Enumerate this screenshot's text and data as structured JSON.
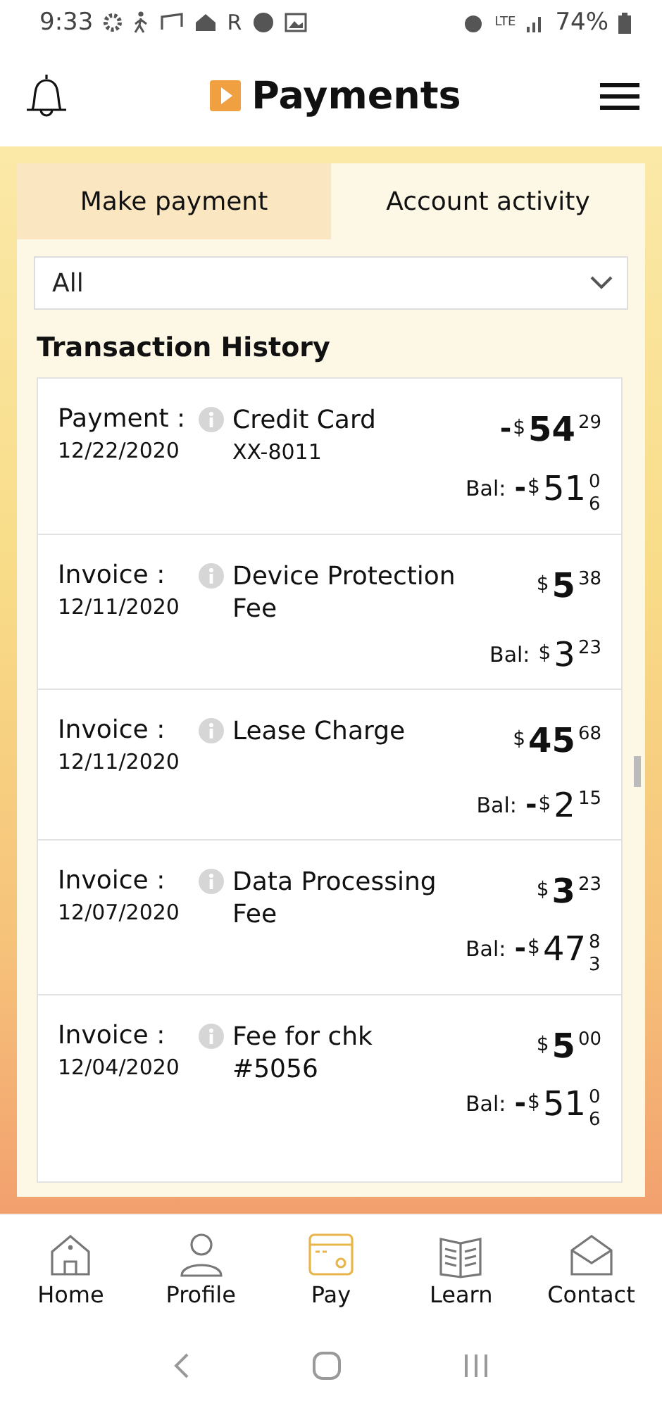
{
  "status_bar": {
    "time": "9:33",
    "carrier_mark": "R",
    "network": "LTE",
    "battery": "74%"
  },
  "header": {
    "title": "Payments"
  },
  "tabs": [
    {
      "label": "Make payment",
      "selected": false
    },
    {
      "label": "Account activity",
      "selected": true
    }
  ],
  "filter": {
    "value": "All"
  },
  "section_title": "Transaction History",
  "transactions": [
    {
      "type": "Payment :",
      "date": "12/22/2020",
      "description": "Credit Card",
      "detail": "XX-8011",
      "amount": {
        "sign": "-",
        "currency": "$",
        "whole": "54",
        "cents": "29"
      },
      "balance_label": "Bal:",
      "balance": {
        "sign": "-",
        "currency": "$",
        "whole": "51",
        "cents": "06"
      }
    },
    {
      "type": "Invoice :",
      "date": "12/11/2020",
      "description": "Device Protection Fee",
      "amount": {
        "currency": "$",
        "whole": "5",
        "cents": "38"
      },
      "balance_label": "Bal:",
      "balance": {
        "currency": "$",
        "whole": "3",
        "cents": "23"
      }
    },
    {
      "type": "Invoice :",
      "date": "12/11/2020",
      "description": "Lease Charge",
      "amount": {
        "currency": "$",
        "whole": "45",
        "cents": "68"
      },
      "balance_label": "Bal:",
      "balance": {
        "sign": "-",
        "currency": "$",
        "whole": "2",
        "cents": "15"
      }
    },
    {
      "type": "Invoice :",
      "date": "12/07/2020",
      "description": "Data Processing Fee",
      "amount": {
        "currency": "$",
        "whole": "3",
        "cents": "23"
      },
      "balance_label": "Bal:",
      "balance": {
        "sign": "-",
        "currency": "$",
        "whole": "47",
        "cents": "83"
      }
    },
    {
      "type": "Invoice :",
      "date": "12/04/2020",
      "description": "Fee for chk #5056",
      "amount": {
        "currency": "$",
        "whole": "5",
        "cents": "00"
      },
      "balance_label": "Bal:",
      "balance": {
        "sign": "-",
        "currency": "$",
        "whole": "51",
        "cents": "06"
      }
    }
  ],
  "bottom_nav": [
    {
      "label": "Home",
      "kind": "home",
      "selected": false
    },
    {
      "label": "Profile",
      "kind": "profile",
      "selected": false
    },
    {
      "label": "Pay",
      "kind": "pay",
      "selected": true
    },
    {
      "label": "Learn",
      "kind": "learn",
      "selected": false
    },
    {
      "label": "Contact",
      "kind": "contact",
      "selected": false
    }
  ]
}
